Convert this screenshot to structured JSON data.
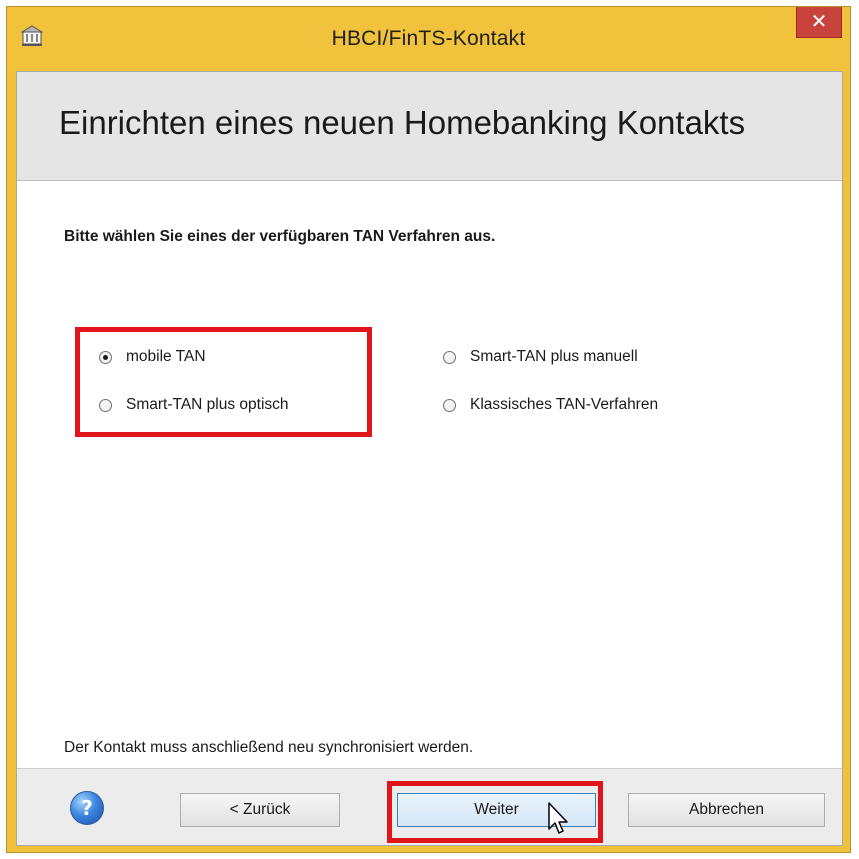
{
  "window": {
    "title": "HBCI/FinTS-Kontakt",
    "close_symbol": "✕",
    "icon": "bank-building-icon"
  },
  "header": {
    "title": "Einrichten eines neuen Homebanking Kontakts"
  },
  "content": {
    "instruction": "Bitte wählen Sie eines der verfügbaren TAN Verfahren aus.",
    "options": [
      {
        "label": "mobile TAN",
        "checked": true
      },
      {
        "label": "Smart-TAN plus optisch",
        "checked": false
      },
      {
        "label": "Smart-TAN plus manuell",
        "checked": false
      },
      {
        "label": "Klassisches TAN-Verfahren",
        "checked": false
      }
    ],
    "note": "Der Kontakt muss anschließend neu synchronisiert werden."
  },
  "footer": {
    "help_symbol": "?",
    "back_label": "< Zurück",
    "next_label": "Weiter",
    "cancel_label": "Abbrechen"
  },
  "colors": {
    "titlebar": "#f1c23b",
    "close_button": "#c7433b",
    "highlight": "#e0141b",
    "header_bg": "#e5e5e5"
  }
}
